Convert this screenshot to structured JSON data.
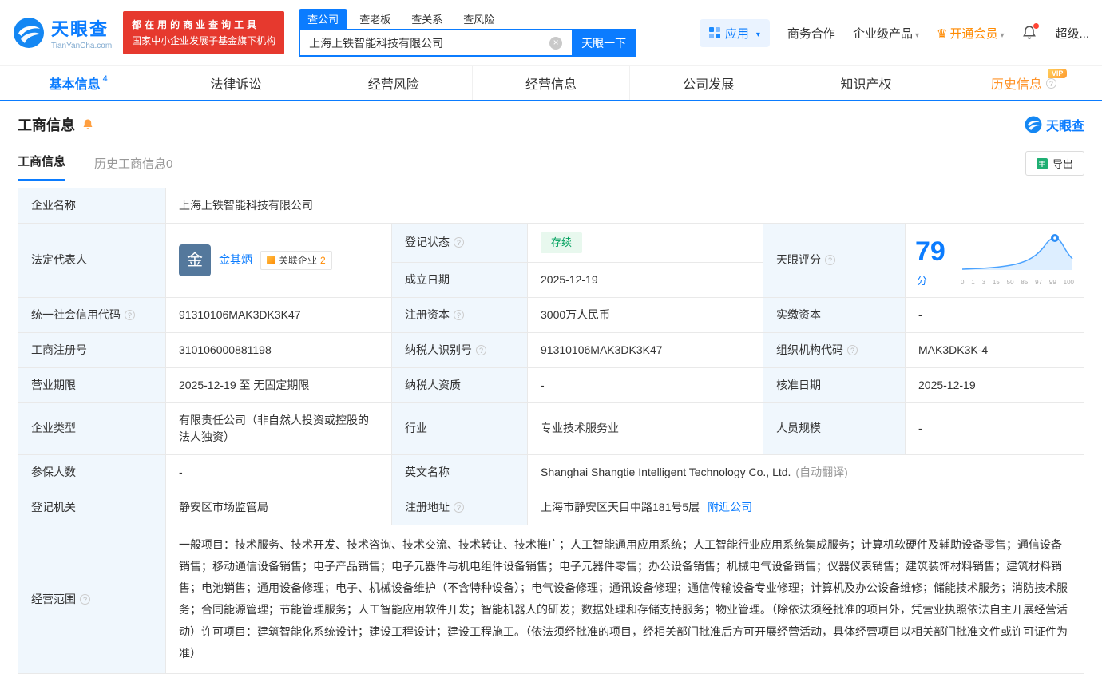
{
  "colors": {
    "accent_blue": "#0b7cff",
    "promo_red": "#e6392e",
    "vip_orange": "#ff9329",
    "status_green": "#00a05e",
    "label_bg": "#f0f7fd"
  },
  "header": {
    "logo": {
      "cn": "天眼查",
      "en": "TianYanCha.com"
    },
    "promo": {
      "line1": "都在用的商业查询工具",
      "line2": "国家中小企业发展子基金旗下机构"
    },
    "search": {
      "tabs": [
        {
          "label": "查公司",
          "active": true
        },
        {
          "label": "查老板",
          "active": false
        },
        {
          "label": "查关系",
          "active": false
        },
        {
          "label": "查风险",
          "active": false
        }
      ],
      "value": "上海上铁智能科技有限公司",
      "button": "天眼一下"
    },
    "apps_label": "应用",
    "links": {
      "cooperation": "商务合作",
      "enterprise": "企业级产品",
      "vip": "开通会员",
      "super": "超级..."
    }
  },
  "nav_tabs": [
    {
      "label": "基本信息",
      "badge": "4",
      "active": true
    },
    {
      "label": "法律诉讼",
      "active": false
    },
    {
      "label": "经营风险",
      "active": false
    },
    {
      "label": "经营信息",
      "active": false
    },
    {
      "label": "公司发展",
      "active": false
    },
    {
      "label": "知识产权",
      "active": false
    },
    {
      "label": "历史信息",
      "active": false,
      "vip_tag": "VIP"
    }
  ],
  "section": {
    "title": "工商信息",
    "brand": "天眼查",
    "subtabs": [
      {
        "label": "工商信息",
        "active": true
      },
      {
        "label": "历史工商信息",
        "count": "0",
        "active": false
      }
    ],
    "export_label": "导出"
  },
  "table": {
    "company_name": {
      "label": "企业名称",
      "value": "上海上铁智能科技有限公司"
    },
    "legal_rep": {
      "label": "法定代表人",
      "avatar": "金",
      "name": "金其炳",
      "related": "关联企业",
      "related_count": "2"
    },
    "reg_status": {
      "label": "登记状态",
      "value": "存续"
    },
    "establish_date": {
      "label": "成立日期",
      "value": "2025-12-19"
    },
    "score": {
      "label": "天眼评分",
      "value": "79",
      "unit": "分",
      "axis": [
        "0",
        "1",
        "3",
        "15",
        "50",
        "85",
        "97",
        "99",
        "100"
      ]
    },
    "credit_code": {
      "label": "统一社会信用代码",
      "value": "91310106MAK3DK3K47"
    },
    "reg_capital": {
      "label": "注册资本",
      "value": "3000万人民币"
    },
    "paid_capital": {
      "label": "实缴资本",
      "value": "-"
    },
    "reg_number": {
      "label": "工商注册号",
      "value": "310106000881198"
    },
    "taxpayer_id": {
      "label": "纳税人识别号",
      "value": "91310106MAK3DK3K47"
    },
    "org_code": {
      "label": "组织机构代码",
      "value": "MAK3DK3K-4"
    },
    "business_term": {
      "label": "营业期限",
      "value": "2025-12-19 至 无固定期限"
    },
    "taxpayer_quality": {
      "label": "纳税人资质",
      "value": "-"
    },
    "approval_date": {
      "label": "核准日期",
      "value": "2025-12-19"
    },
    "company_type": {
      "label": "企业类型",
      "value": "有限责任公司（非自然人投资或控股的法人独资）"
    },
    "industry": {
      "label": "行业",
      "value": "专业技术服务业"
    },
    "staff_size": {
      "label": "人员规模",
      "value": "-"
    },
    "insured_count": {
      "label": "参保人数",
      "value": "-"
    },
    "english_name": {
      "label": "英文名称",
      "value": "Shanghai Shangtie Intelligent Technology Co., Ltd.",
      "note": "(自动翻译)"
    },
    "reg_authority": {
      "label": "登记机关",
      "value": "静安区市场监管局"
    },
    "reg_address": {
      "label": "注册地址",
      "value": "上海市静安区天目中路181号5层",
      "link": "附近公司"
    },
    "business_scope": {
      "label": "经营范围",
      "value": "一般项目：技术服务、技术开发、技术咨询、技术交流、技术转让、技术推广；人工智能通用应用系统；人工智能行业应用系统集成服务；计算机软硬件及辅助设备零售；通信设备销售；移动通信设备销售；电子产品销售；电子元器件与机电组件设备销售；电子元器件零售；办公设备销售；机械电气设备销售；仪器仪表销售；建筑装饰材料销售；建筑材料销售；电池销售；通用设备修理；电子、机械设备维护（不含特种设备）；电气设备修理；通讯设备修理；通信传输设备专业修理；计算机及办公设备维修；储能技术服务；消防技术服务；合同能源管理；节能管理服务；人工智能应用软件开发；智能机器人的研发；数据处理和存储支持服务；物业管理。（除依法须经批准的项目外，凭营业执照依法自主开展经营活动）许可项目：建筑智能化系统设计；建设工程设计；建设工程施工。（依法须经批准的项目，经相关部门批准后方可开展经营活动，具体经营项目以相关部门批准文件或许可证件为准）"
    }
  }
}
